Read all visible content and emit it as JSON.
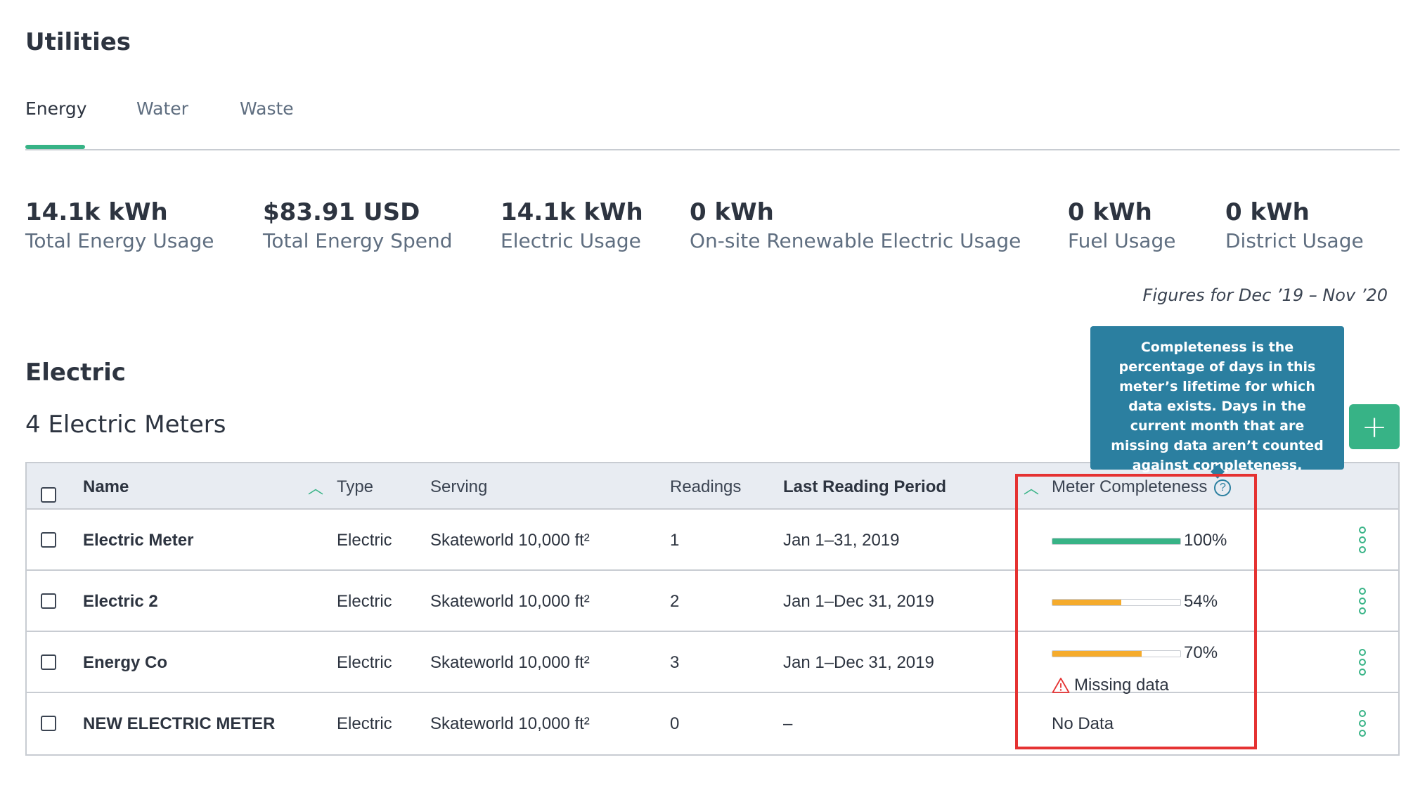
{
  "page": {
    "title": "Utilities"
  },
  "tabs": [
    {
      "label": "Energy",
      "active": true
    },
    {
      "label": "Water",
      "active": false
    },
    {
      "label": "Waste",
      "active": false
    }
  ],
  "stats": [
    {
      "value": "14.1k kWh",
      "label": "Total Energy Usage"
    },
    {
      "value": "$83.91 USD",
      "label": "Total Energy Spend"
    },
    {
      "value": "14.1k kWh",
      "label": "Electric Usage"
    },
    {
      "value": "0 kWh",
      "label": "On-site Renewable Electric Usage"
    },
    {
      "value": "0 kWh",
      "label": "Fuel Usage"
    },
    {
      "value": "0 kWh",
      "label": "District Usage"
    }
  ],
  "figures_note": "Figures for Dec ’19 – Nov ’20",
  "section": {
    "title": "Electric",
    "meter_count": "4 Electric Meters",
    "add_label": "+"
  },
  "tooltip": {
    "text": "Completeness is the percentage of days in this meter’s lifetime for which data exists. Days in the current month that are missing data aren’t counted against completeness."
  },
  "table": {
    "headers": {
      "name": "Name",
      "type": "Type",
      "serving": "Serving",
      "readings": "Readings",
      "last_period": "Last Reading Period",
      "completeness": "Meter Completeness"
    },
    "rows": [
      {
        "name": "Electric Meter",
        "type": "Electric",
        "serving": "Skateworld 10,000 ft²",
        "readings": "1",
        "last_period": "Jan 1–31, 2019",
        "completeness": 1.0,
        "completeness_label": "100%",
        "bar_color": "#37b386",
        "warning": ""
      },
      {
        "name": "Electric 2",
        "type": "Electric",
        "serving": "Skateworld 10,000 ft²",
        "readings": "2",
        "last_period": "Jan 1–Dec 31, 2019",
        "completeness": 0.54,
        "completeness_label": "54%",
        "bar_color": "#f5ab2c",
        "warning": ""
      },
      {
        "name": "Energy Co",
        "type": "Electric",
        "serving": "Skateworld 10,000 ft²",
        "readings": "3",
        "last_period": "Jan 1–Dec 31, 2019",
        "completeness": 0.7,
        "completeness_label": "70%",
        "bar_color": "#f5ab2c",
        "warning": "Missing data"
      },
      {
        "name": "NEW ELECTRIC METER",
        "type": "Electric",
        "serving": "Skateworld 10,000 ft²",
        "readings": "0",
        "last_period": "–",
        "completeness": null,
        "completeness_label": "No Data",
        "bar_color": "",
        "warning": ""
      }
    ]
  },
  "colors": {
    "accent": "#37b386",
    "tooltip": "#2b7fa0",
    "warning": "#f5ab2c",
    "highlight": "#e53232"
  }
}
